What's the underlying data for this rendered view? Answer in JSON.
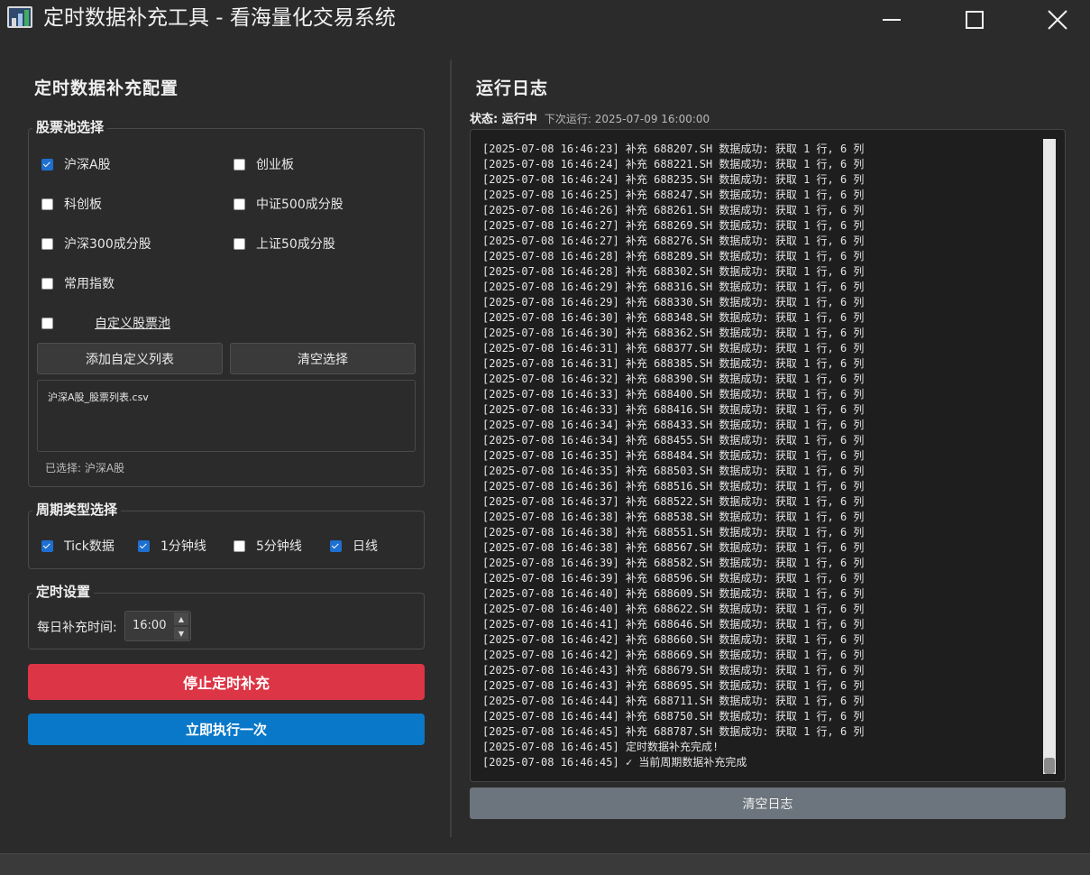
{
  "window": {
    "title": "定时数据补充工具 - 看海量化交易系统",
    "icon": "chart-app-icon",
    "controls": [
      "minimize-icon",
      "maximize-icon",
      "close-icon"
    ]
  },
  "config": {
    "title": "定时数据补充配置",
    "stock_pool": {
      "title": "股票池选择",
      "options": [
        {
          "label": "沪深A股",
          "checked": true
        },
        {
          "label": "创业板",
          "checked": false
        },
        {
          "label": "科创板",
          "checked": false
        },
        {
          "label": "中证500成分股",
          "checked": false
        },
        {
          "label": "沪深300成分股",
          "checked": false
        },
        {
          "label": "上证50成分股",
          "checked": false
        },
        {
          "label": "常用指数",
          "checked": false
        }
      ],
      "custom_label": "自定义股票池",
      "custom_checked": false,
      "add_button": "添加自定义列表",
      "clear_button": "清空选择",
      "file_entry": "沪深A股_股票列表.csv",
      "selected_text": "已选择: 沪深A股"
    },
    "period": {
      "title": "周期类型选择",
      "options": [
        {
          "label": "Tick数据",
          "checked": true
        },
        {
          "label": "1分钟线",
          "checked": true
        },
        {
          "label": "5分钟线",
          "checked": false
        },
        {
          "label": "日线",
          "checked": true
        }
      ]
    },
    "schedule": {
      "title": "定时设置",
      "time_label": "每日补充时间:",
      "time_value": "16:00"
    },
    "stop_button": "停止定时补充",
    "run_now_button": "立即执行一次"
  },
  "log": {
    "title": "运行日志",
    "status_label": "状态: 运行中",
    "next_run": "下次运行: 2025-07-09 16:00:00",
    "clear_button": "清空日志",
    "lines": [
      "[2025-07-08 16:46:23] 补充 688207.SH 数据成功: 获取 1 行, 6 列",
      "[2025-07-08 16:46:24] 补充 688221.SH 数据成功: 获取 1 行, 6 列",
      "[2025-07-08 16:46:24] 补充 688235.SH 数据成功: 获取 1 行, 6 列",
      "[2025-07-08 16:46:25] 补充 688247.SH 数据成功: 获取 1 行, 6 列",
      "[2025-07-08 16:46:26] 补充 688261.SH 数据成功: 获取 1 行, 6 列",
      "[2025-07-08 16:46:27] 补充 688269.SH 数据成功: 获取 1 行, 6 列",
      "[2025-07-08 16:46:27] 补充 688276.SH 数据成功: 获取 1 行, 6 列",
      "[2025-07-08 16:46:28] 补充 688289.SH 数据成功: 获取 1 行, 6 列",
      "[2025-07-08 16:46:28] 补充 688302.SH 数据成功: 获取 1 行, 6 列",
      "[2025-07-08 16:46:29] 补充 688316.SH 数据成功: 获取 1 行, 6 列",
      "[2025-07-08 16:46:29] 补充 688330.SH 数据成功: 获取 1 行, 6 列",
      "[2025-07-08 16:46:30] 补充 688348.SH 数据成功: 获取 1 行, 6 列",
      "[2025-07-08 16:46:30] 补充 688362.SH 数据成功: 获取 1 行, 6 列",
      "[2025-07-08 16:46:31] 补充 688377.SH 数据成功: 获取 1 行, 6 列",
      "[2025-07-08 16:46:31] 补充 688385.SH 数据成功: 获取 1 行, 6 列",
      "[2025-07-08 16:46:32] 补充 688390.SH 数据成功: 获取 1 行, 6 列",
      "[2025-07-08 16:46:33] 补充 688400.SH 数据成功: 获取 1 行, 6 列",
      "[2025-07-08 16:46:33] 补充 688416.SH 数据成功: 获取 1 行, 6 列",
      "[2025-07-08 16:46:34] 补充 688433.SH 数据成功: 获取 1 行, 6 列",
      "[2025-07-08 16:46:34] 补充 688455.SH 数据成功: 获取 1 行, 6 列",
      "[2025-07-08 16:46:35] 补充 688484.SH 数据成功: 获取 1 行, 6 列",
      "[2025-07-08 16:46:35] 补充 688503.SH 数据成功: 获取 1 行, 6 列",
      "[2025-07-08 16:46:36] 补充 688516.SH 数据成功: 获取 1 行, 6 列",
      "[2025-07-08 16:46:37] 补充 688522.SH 数据成功: 获取 1 行, 6 列",
      "[2025-07-08 16:46:38] 补充 688538.SH 数据成功: 获取 1 行, 6 列",
      "[2025-07-08 16:46:38] 补充 688551.SH 数据成功: 获取 1 行, 6 列",
      "[2025-07-08 16:46:38] 补充 688567.SH 数据成功: 获取 1 行, 6 列",
      "[2025-07-08 16:46:39] 补充 688582.SH 数据成功: 获取 1 行, 6 列",
      "[2025-07-08 16:46:39] 补充 688596.SH 数据成功: 获取 1 行, 6 列",
      "[2025-07-08 16:46:40] 补充 688609.SH 数据成功: 获取 1 行, 6 列",
      "[2025-07-08 16:46:40] 补充 688622.SH 数据成功: 获取 1 行, 6 列",
      "[2025-07-08 16:46:41] 补充 688646.SH 数据成功: 获取 1 行, 6 列",
      "[2025-07-08 16:46:42] 补充 688660.SH 数据成功: 获取 1 行, 6 列",
      "[2025-07-08 16:46:42] 补充 688669.SH 数据成功: 获取 1 行, 6 列",
      "[2025-07-08 16:46:43] 补充 688679.SH 数据成功: 获取 1 行, 6 列",
      "[2025-07-08 16:46:43] 补充 688695.SH 数据成功: 获取 1 行, 6 列",
      "[2025-07-08 16:46:44] 补充 688711.SH 数据成功: 获取 1 行, 6 列",
      "[2025-07-08 16:46:44] 补充 688750.SH 数据成功: 获取 1 行, 6 列",
      "[2025-07-08 16:46:45] 补充 688787.SH 数据成功: 获取 1 行, 6 列",
      "[2025-07-08 16:46:45] 定时数据补充完成!",
      "[2025-07-08 16:46:45] ✓ 当前周期数据补充完成"
    ]
  },
  "colors": {
    "background": "#2b2b2b",
    "stop_button": "#dc3545",
    "run_button": "#0a78c8",
    "clear_log_button": "#6c757d",
    "checkbox_checked": "#1e6fd0"
  }
}
